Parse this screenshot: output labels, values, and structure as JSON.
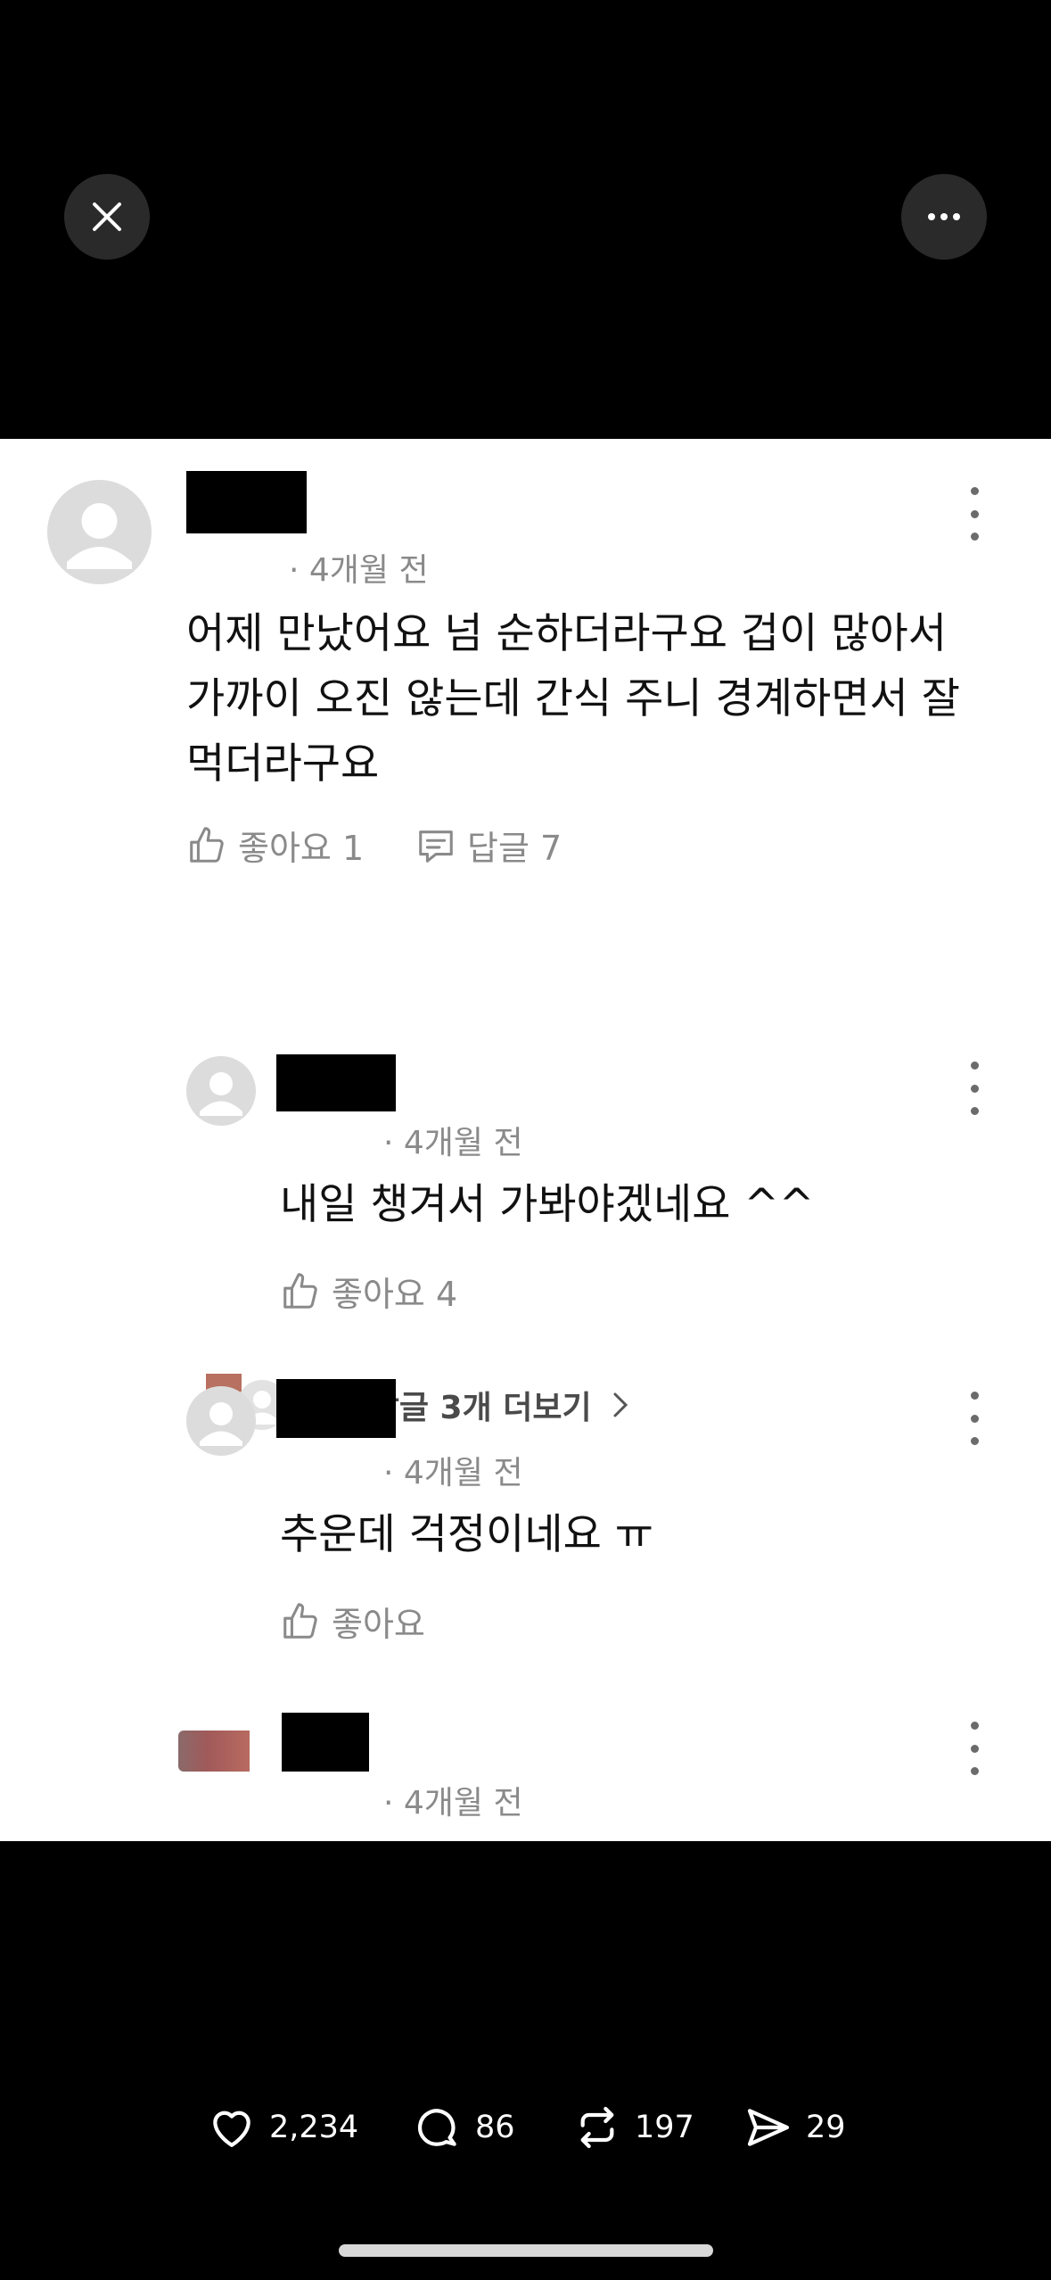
{
  "top_bar": {
    "close_icon": "close-icon",
    "more_icon": "more-horizontal-icon"
  },
  "comment": {
    "time": "· 4개월 전",
    "body": "어제 만났어요 넘 순하더라구요 겁이 많아서 가까이 오진 않는데 간식 주니 경계하면서 잘 먹더라구요",
    "like_label": "좋아요 1",
    "reply_label": "답글 7"
  },
  "prev_replies_label": "이전 답글 3개 더보기",
  "replies": [
    {
      "time": "· 4개월 전",
      "body": "내일 챙겨서 가봐야겠네요 ^^",
      "like_label": "좋아요 4"
    },
    {
      "time": "· 4개월 전",
      "body": "추운데 걱정이네요 ㅠ",
      "like_label": "좋아요"
    },
    {
      "time": "· 4개월 전"
    }
  ],
  "bottom_bar": {
    "likes": "2,234",
    "comments": "86",
    "reposts": "197",
    "shares": "29"
  },
  "colors": {
    "background": "#000000",
    "card": "#ffffff",
    "meta_text": "#8a8a8a",
    "body_text": "#111111"
  }
}
